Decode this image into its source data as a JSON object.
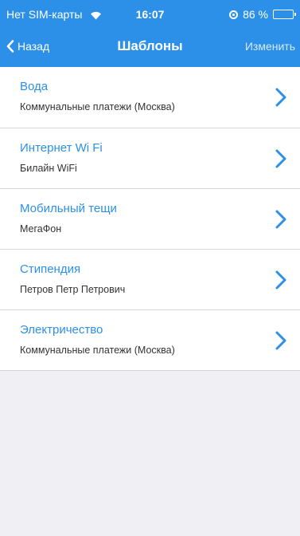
{
  "status_bar": {
    "carrier": "Нет SIM-карты",
    "time": "16:07",
    "battery": "86 %",
    "battery_level": 0.86
  },
  "navbar": {
    "back_label": "Назад",
    "title": "Шаблоны",
    "edit_label": "Изменить"
  },
  "templates": [
    {
      "title": "Вода",
      "subtitle": "Коммунальные платежи (Москва)"
    },
    {
      "title": "Интернет Wi Fi",
      "subtitle": "Билайн WiFi"
    },
    {
      "title": "Мобильный тещи",
      "subtitle": "МегаФон"
    },
    {
      "title": "Стипендия",
      "subtitle": "Петров Петр Петрович"
    },
    {
      "title": "Электричество",
      "subtitle": "Коммунальные платежи (Москва)"
    }
  ],
  "colors": {
    "accent": "#2c90e8",
    "background": "#efeff4"
  }
}
